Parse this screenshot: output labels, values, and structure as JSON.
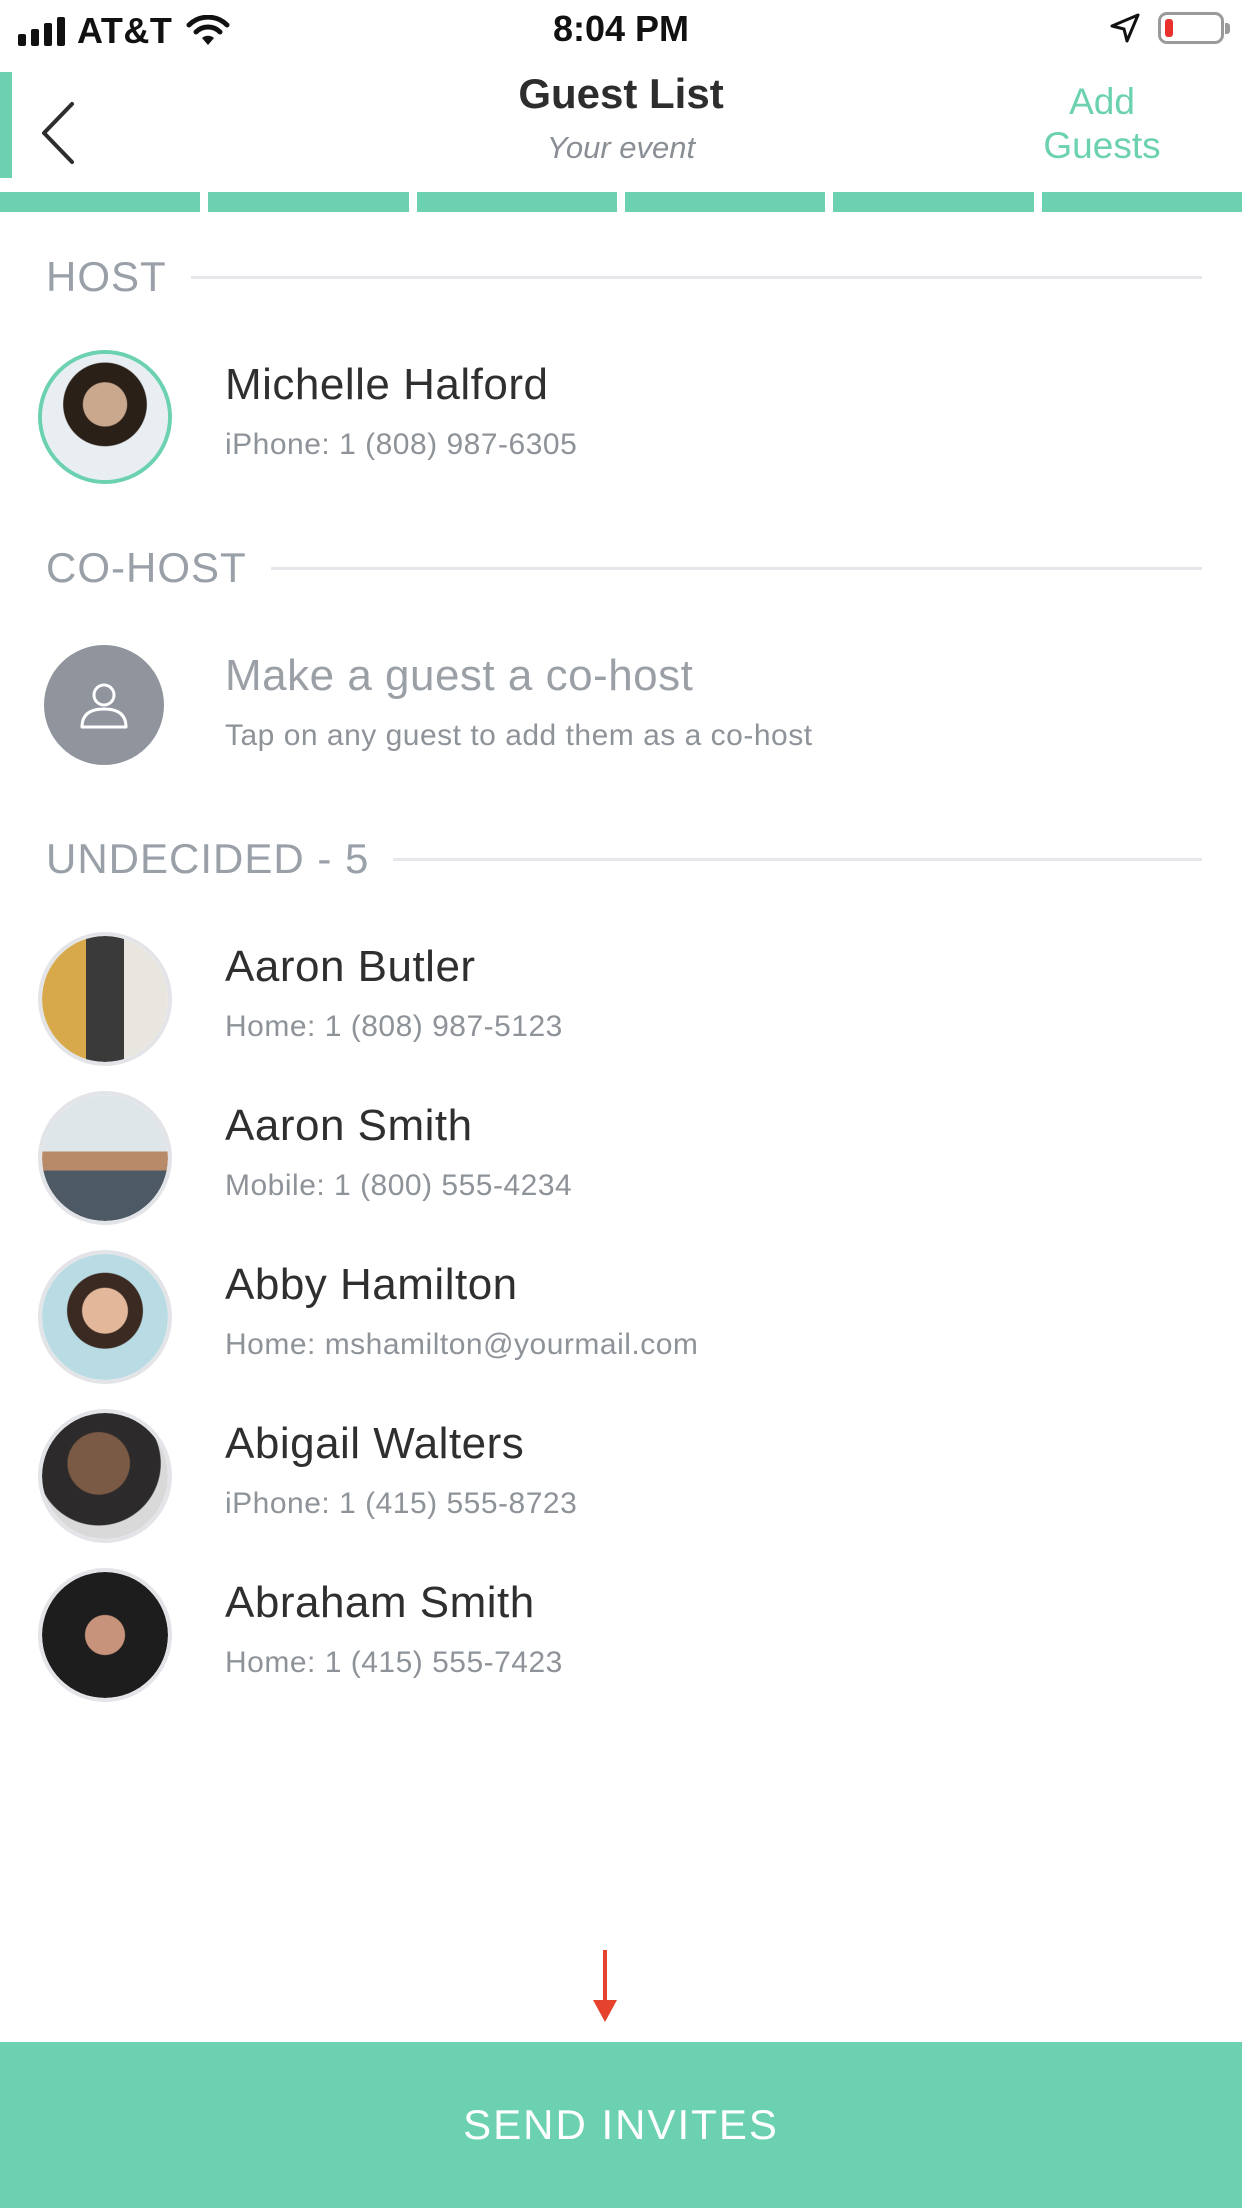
{
  "status_bar": {
    "carrier": "AT&T",
    "time": "8:04 PM",
    "battery_color": "#e8322b"
  },
  "nav": {
    "title": "Guest List",
    "subtitle": "Your event",
    "add_guests_line1": "Add",
    "add_guests_line2": "Guests",
    "back_icon": "chevron-left-icon"
  },
  "theme": {
    "accent": "#6bd1b0",
    "text_primary": "#2f2f2f",
    "text_secondary": "#8e9399"
  },
  "progress_segments": 6,
  "sections": {
    "host": "HOST",
    "cohost": "CO-HOST",
    "undecided": "UNDECIDED - 5"
  },
  "host": {
    "name": "Michelle Halford",
    "detail": "iPhone: 1 (808) 987-6305"
  },
  "cohost_placeholder": {
    "title": "Make a guest a co-host",
    "detail": "Tap on any guest to add them as a co-host",
    "icon": "person-icon"
  },
  "guests": [
    {
      "name": "Aaron Butler",
      "detail": "Home: 1 (808) 987-5123"
    },
    {
      "name": "Aaron Smith",
      "detail": "Mobile: 1 (800) 555-4234"
    },
    {
      "name": "Abby Hamilton",
      "detail": "Home: mshamilton@yourmail.com"
    },
    {
      "name": "Abigail Walters",
      "detail": "iPhone: 1 (415) 555-8723"
    },
    {
      "name": "Abraham Smith",
      "detail": "Home: 1 (415) 555-7423"
    }
  ],
  "send_button": {
    "label": "SEND INVITES"
  }
}
